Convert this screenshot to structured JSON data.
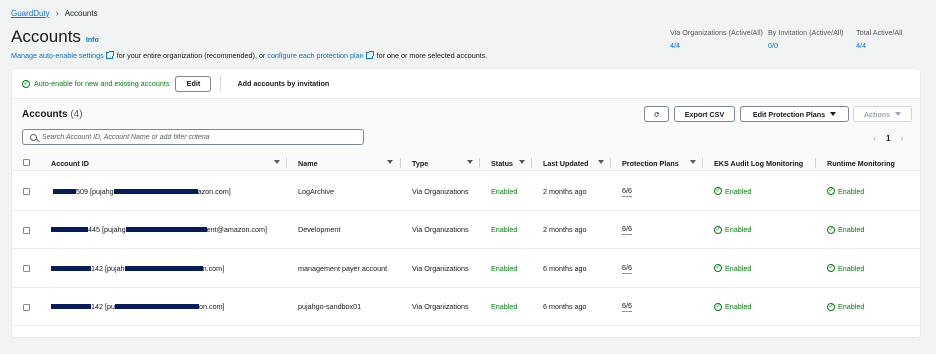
{
  "breadcrumb": {
    "root": "GuardDuty",
    "current": "Accounts"
  },
  "page": {
    "title": "Accounts",
    "info": "Info",
    "subtitle": {
      "link1": "Manage auto-enable settings",
      "text1": "for your entire organization (recommended), or",
      "link2": "configure each protection plan",
      "text2": "for one or more selected accounts."
    }
  },
  "stats": [
    {
      "label": "Via Organizations (Active/All)",
      "value": "4/4"
    },
    {
      "label": "By Invitation (Active/All)",
      "value": "0/0"
    },
    {
      "label": "Total Active/All",
      "value": "4/4"
    }
  ],
  "autobar": {
    "status": "Auto-enable for new and existing accounts",
    "edit": "Edit",
    "add": "Add accounts by invitation"
  },
  "table": {
    "title": "Accounts",
    "count": "(4)",
    "buttons": {
      "export": "Export CSV",
      "edit_plans": "Edit Protection Plans",
      "actions": "Actions"
    },
    "search_placeholder": "Search Account ID, Account Name or add filter criteria",
    "pagination": {
      "prev": "‹",
      "page": "1",
      "next": "›"
    },
    "columns": [
      "Account ID",
      "Name",
      "Type",
      "Status",
      "Last Updated",
      "Protection Plans",
      "EKS Audit Log Monitoring",
      "Runtime Monitoring"
    ],
    "rows": [
      {
        "id_prefix": "",
        "id_suffix": "509 [pujahg",
        "id_end": "azon.com]",
        "name": "LogArchive",
        "type": "Via Organizations",
        "status": "Enabled",
        "updated": "2 months ago",
        "plans": "6/6",
        "eks": "Enabled",
        "runtime": "Enabled"
      },
      {
        "id_prefix": "",
        "id_suffix": "445 [pujahg",
        "id_end": "ent@amazon.com]",
        "name": "Development",
        "type": "Via Organizations",
        "status": "Enabled",
        "updated": "2 months ago",
        "plans": "6/6",
        "eks": "Enabled",
        "runtime": "Enabled"
      },
      {
        "id_prefix": "",
        "id_suffix": "142 [pujah",
        "id_end": "n.com]",
        "name": "management payer account",
        "type": "Via Organizations",
        "status": "Enabled",
        "updated": "6 months ago",
        "plans": "6/6",
        "eks": "Enabled",
        "runtime": "Enabled"
      },
      {
        "id_prefix": "",
        "id_suffix": "142 [pu",
        "id_end": "on.com]",
        "name": "pujahgo-sandbox01",
        "type": "Via Organizations",
        "status": "Enabled",
        "updated": "6 months ago",
        "plans": "6/6",
        "eks": "Enabled",
        "runtime": "Enabled"
      }
    ]
  },
  "colors": {
    "link": "#0972d3",
    "success": "#037f0c",
    "redaction": "#071c5a"
  },
  "icons": [
    "chevron-right-icon",
    "external-link-icon",
    "check-circle-icon",
    "refresh-icon",
    "caret-down-icon",
    "search-icon",
    "sort-icon"
  ]
}
